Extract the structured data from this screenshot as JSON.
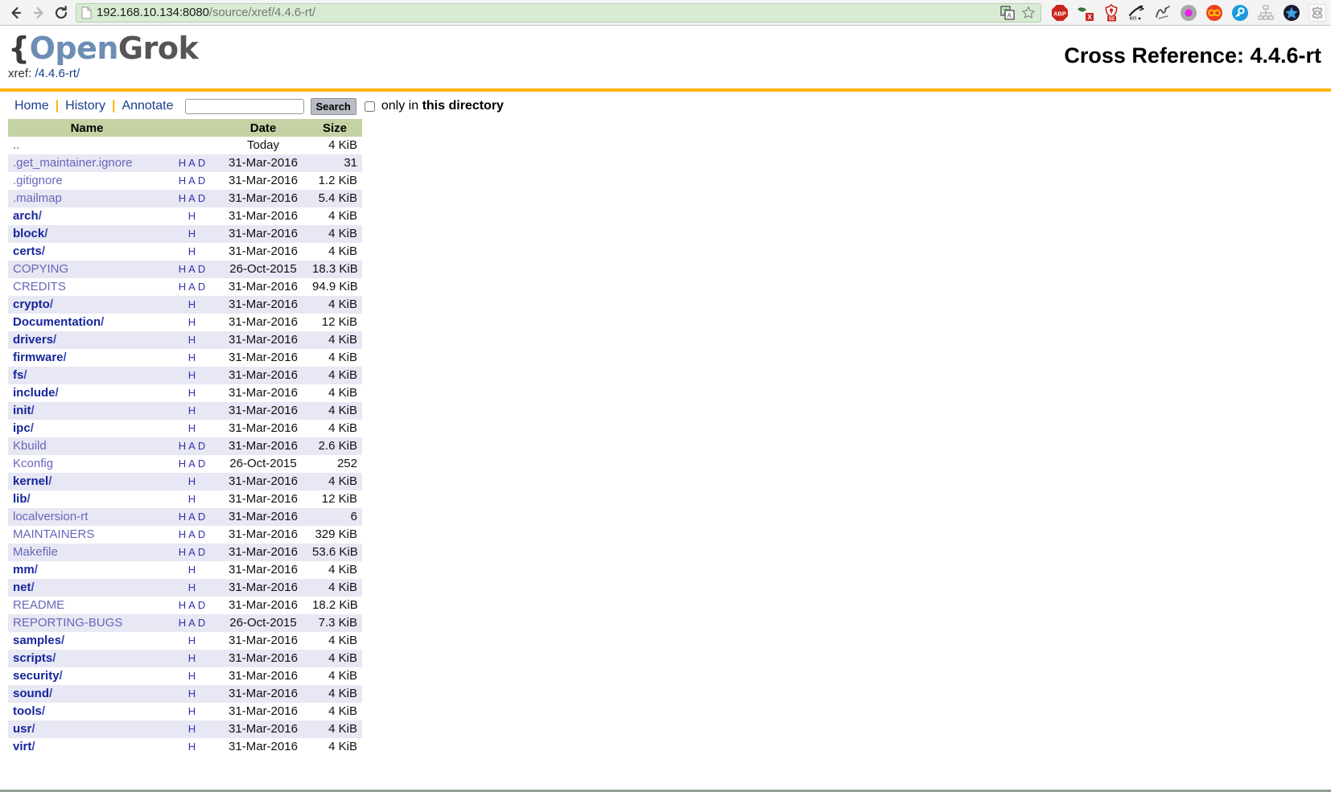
{
  "browser": {
    "back_icon": "back-arrow-icon",
    "forward_icon": "forward-arrow-icon",
    "reload_icon": "reload-icon",
    "url_host": "192.168.10.134:8080",
    "url_path": "/source/xref/4.4.6-rt/",
    "url_full": "192.168.10.134:8080/source/xref/4.4.6-rt/",
    "url_bar_bg": "#d8ecd3",
    "inline_icons": [
      "translate-icon",
      "bookmark-star-icon"
    ],
    "extension_icons": [
      "adblock-plus-icon",
      "noscript-icon",
      "ublock-origin-icon",
      "english-dictionary-icon",
      "scribble-icon",
      "magenta-dot-icon",
      "infinity-icon",
      "keyfinder-icon",
      "sitemap-icon",
      "blue-star-icon",
      "gear-icon"
    ]
  },
  "header": {
    "logo_brace": "{",
    "logo_open": "Open",
    "logo_grok": "Grok",
    "xref_label": "xref: ",
    "xref_path": "/4.4.6-rt/",
    "cross_reference_title": "Cross Reference: 4.4.6-rt",
    "rule_color": "#ffb400"
  },
  "menu": {
    "home": "Home",
    "history": "History",
    "annotate": "Annotate",
    "separator": "|",
    "search_value": "",
    "search_placeholder": "",
    "search_button": "Search",
    "only_in_text": "only in ",
    "this_directory": "this directory",
    "checkbox_checked": false
  },
  "table": {
    "headers": {
      "name": "Name",
      "had": "",
      "date": "Date",
      "size": "Size"
    },
    "rows": [
      {
        "name": "..",
        "type": "updir",
        "links": [],
        "date": "Today",
        "size": "4 KiB"
      },
      {
        "name": ".get_maintainer.ignore",
        "type": "file",
        "links": [
          "H",
          "A",
          "D"
        ],
        "date": "31-Mar-2016",
        "size": "31"
      },
      {
        "name": ".gitignore",
        "type": "file",
        "links": [
          "H",
          "A",
          "D"
        ],
        "date": "31-Mar-2016",
        "size": "1.2 KiB"
      },
      {
        "name": ".mailmap",
        "type": "file",
        "links": [
          "H",
          "A",
          "D"
        ],
        "date": "31-Mar-2016",
        "size": "5.4 KiB"
      },
      {
        "name": "arch",
        "type": "dir",
        "links": [
          "H"
        ],
        "date": "31-Mar-2016",
        "size": "4 KiB"
      },
      {
        "name": "block",
        "type": "dir",
        "links": [
          "H"
        ],
        "date": "31-Mar-2016",
        "size": "4 KiB"
      },
      {
        "name": "certs",
        "type": "dir",
        "links": [
          "H"
        ],
        "date": "31-Mar-2016",
        "size": "4 KiB"
      },
      {
        "name": "COPYING",
        "type": "file",
        "links": [
          "H",
          "A",
          "D"
        ],
        "date": "26-Oct-2015",
        "size": "18.3 KiB"
      },
      {
        "name": "CREDITS",
        "type": "file",
        "links": [
          "H",
          "A",
          "D"
        ],
        "date": "31-Mar-2016",
        "size": "94.9 KiB"
      },
      {
        "name": "crypto",
        "type": "dir",
        "links": [
          "H"
        ],
        "date": "31-Mar-2016",
        "size": "4 KiB"
      },
      {
        "name": "Documentation",
        "type": "dir",
        "links": [
          "H"
        ],
        "date": "31-Mar-2016",
        "size": "12 KiB"
      },
      {
        "name": "drivers",
        "type": "dir",
        "links": [
          "H"
        ],
        "date": "31-Mar-2016",
        "size": "4 KiB"
      },
      {
        "name": "firmware",
        "type": "dir",
        "links": [
          "H"
        ],
        "date": "31-Mar-2016",
        "size": "4 KiB"
      },
      {
        "name": "fs",
        "type": "dir",
        "links": [
          "H"
        ],
        "date": "31-Mar-2016",
        "size": "4 KiB"
      },
      {
        "name": "include",
        "type": "dir",
        "links": [
          "H"
        ],
        "date": "31-Mar-2016",
        "size": "4 KiB"
      },
      {
        "name": "init",
        "type": "dir",
        "links": [
          "H"
        ],
        "date": "31-Mar-2016",
        "size": "4 KiB"
      },
      {
        "name": "ipc",
        "type": "dir",
        "links": [
          "H"
        ],
        "date": "31-Mar-2016",
        "size": "4 KiB"
      },
      {
        "name": "Kbuild",
        "type": "file",
        "links": [
          "H",
          "A",
          "D"
        ],
        "date": "31-Mar-2016",
        "size": "2.6 KiB"
      },
      {
        "name": "Kconfig",
        "type": "file",
        "links": [
          "H",
          "A",
          "D"
        ],
        "date": "26-Oct-2015",
        "size": "252"
      },
      {
        "name": "kernel",
        "type": "dir",
        "links": [
          "H"
        ],
        "date": "31-Mar-2016",
        "size": "4 KiB"
      },
      {
        "name": "lib",
        "type": "dir",
        "links": [
          "H"
        ],
        "date": "31-Mar-2016",
        "size": "12 KiB"
      },
      {
        "name": "localversion-rt",
        "type": "file",
        "links": [
          "H",
          "A",
          "D"
        ],
        "date": "31-Mar-2016",
        "size": "6"
      },
      {
        "name": "MAINTAINERS",
        "type": "file",
        "links": [
          "H",
          "A",
          "D"
        ],
        "date": "31-Mar-2016",
        "size": "329 KiB"
      },
      {
        "name": "Makefile",
        "type": "file",
        "links": [
          "H",
          "A",
          "D"
        ],
        "date": "31-Mar-2016",
        "size": "53.6 KiB"
      },
      {
        "name": "mm",
        "type": "dir",
        "links": [
          "H"
        ],
        "date": "31-Mar-2016",
        "size": "4 KiB"
      },
      {
        "name": "net",
        "type": "dir",
        "links": [
          "H"
        ],
        "date": "31-Mar-2016",
        "size": "4 KiB"
      },
      {
        "name": "README",
        "type": "file",
        "links": [
          "H",
          "A",
          "D"
        ],
        "date": "31-Mar-2016",
        "size": "18.2 KiB"
      },
      {
        "name": "REPORTING-BUGS",
        "type": "file",
        "links": [
          "H",
          "A",
          "D"
        ],
        "date": "26-Oct-2015",
        "size": "7.3 KiB"
      },
      {
        "name": "samples",
        "type": "dir",
        "links": [
          "H"
        ],
        "date": "31-Mar-2016",
        "size": "4 KiB"
      },
      {
        "name": "scripts",
        "type": "dir",
        "links": [
          "H"
        ],
        "date": "31-Mar-2016",
        "size": "4 KiB"
      },
      {
        "name": "security",
        "type": "dir",
        "links": [
          "H"
        ],
        "date": "31-Mar-2016",
        "size": "4 KiB"
      },
      {
        "name": "sound",
        "type": "dir",
        "links": [
          "H"
        ],
        "date": "31-Mar-2016",
        "size": "4 KiB"
      },
      {
        "name": "tools",
        "type": "dir",
        "links": [
          "H"
        ],
        "date": "31-Mar-2016",
        "size": "4 KiB"
      },
      {
        "name": "usr",
        "type": "dir",
        "links": [
          "H"
        ],
        "date": "31-Mar-2016",
        "size": "4 KiB"
      },
      {
        "name": "virt",
        "type": "dir",
        "links": [
          "H"
        ],
        "date": "31-Mar-2016",
        "size": "4 KiB"
      }
    ]
  },
  "colors": {
    "header_row_bg": "#c5d3a4",
    "alt_row_bg": "#e7e8f3",
    "dir_link": "#16259b",
    "file_link": "#6666bb",
    "had_link": "#3333aa",
    "accent_rule": "#ffb400"
  }
}
